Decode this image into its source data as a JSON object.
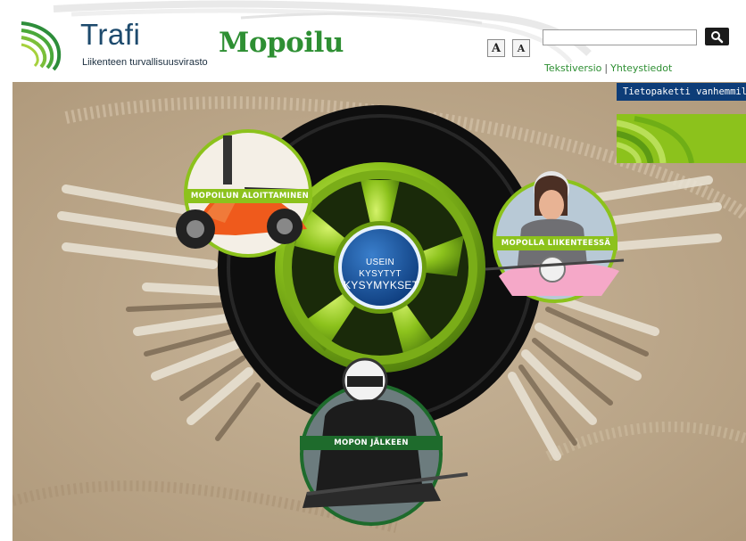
{
  "header": {
    "logo_name": "Trafi",
    "logo_subtitle": "Liikenteen turvallisuusvirasto",
    "site_title": "Mopoilu",
    "font_small_label": "A",
    "font_large_label": "A",
    "search": {
      "value": "",
      "placeholder": ""
    },
    "links": {
      "text_version": "Tekstiversio",
      "separator": "|",
      "contact": "Yhteystiedot"
    }
  },
  "side": {
    "info_tab": "Tietopaketti vanhemmille"
  },
  "nav": {
    "start": "MOPOILUN ALOITTAMINEN",
    "traffic": "MOPOLLA LIIKENTEESSÄ",
    "after": "MOPON JÄLKEEN",
    "faq_line1": "USEIN KYSYTYT",
    "faq_line2": "KYSYMYKSET"
  },
  "colors": {
    "brand_green": "#2e8f33",
    "logo_blue": "#1d4a6d",
    "tab_blue": "#0e3d78",
    "lime": "#8cc21c",
    "label_dark_green": "#1e6b2c"
  }
}
